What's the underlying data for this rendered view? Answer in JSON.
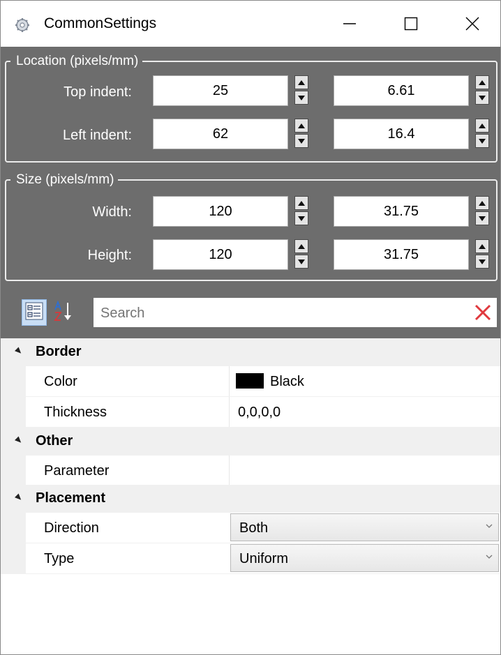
{
  "window": {
    "title": "CommonSettings",
    "app_icon": "gear-icon",
    "controls": {
      "minimize_icon": "minimize-icon",
      "maximize_icon": "maximize-icon",
      "close_icon": "close-icon"
    }
  },
  "location": {
    "title": "Location (pixels/mm)",
    "rows": [
      {
        "label": "Top indent:",
        "pixels": "25",
        "mm": "6.61"
      },
      {
        "label": "Left indent:",
        "pixels": "62",
        "mm": "16.4"
      }
    ]
  },
  "size": {
    "title": "Size (pixels/mm)",
    "rows": [
      {
        "label": "Width:",
        "pixels": "120",
        "mm": "31.75"
      },
      {
        "label": "Height:",
        "pixels": "120",
        "mm": "31.75"
      }
    ]
  },
  "toolbar": {
    "categorized_icon": "categorized-view-icon",
    "alphabetical_icon": "sort-az-icon",
    "search_placeholder": "Search",
    "search_value": "",
    "clear_icon": "clear-search-icon"
  },
  "properties": {
    "categories": [
      {
        "name": "Border",
        "props": [
          {
            "name": "Color",
            "value": "Black",
            "swatch": "#000000"
          },
          {
            "name": "Thickness",
            "value": "0,0,0,0"
          }
        ]
      },
      {
        "name": "Other",
        "props": [
          {
            "name": "Parameter",
            "value": ""
          }
        ]
      },
      {
        "name": "Placement",
        "props": [
          {
            "name": "Direction",
            "value": "Both"
          },
          {
            "name": "Type",
            "value": "Uniform"
          }
        ]
      }
    ]
  },
  "colors": {
    "panel_background": "#6d6d6d",
    "category_background": "#f0f0f0",
    "clear_icon": "#e0393e"
  }
}
